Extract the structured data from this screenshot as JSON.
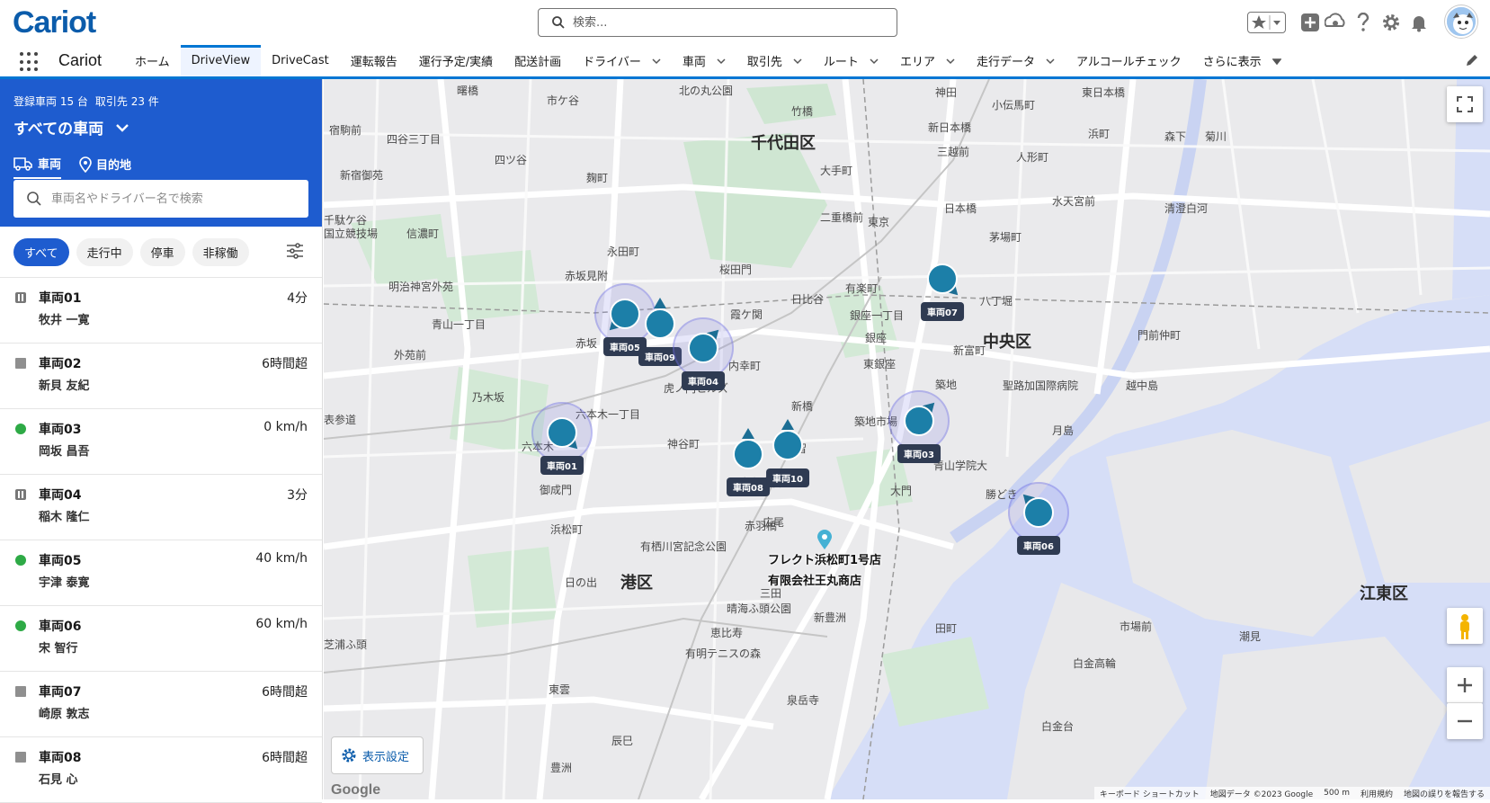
{
  "header": {
    "logo": "Cariot",
    "search_placeholder": "検索..."
  },
  "nav": {
    "app_name": "Cariot",
    "tabs": [
      {
        "label": "ホーム",
        "dropdown": false
      },
      {
        "label": "DriveView",
        "dropdown": false,
        "active": true
      },
      {
        "label": "DriveCast",
        "dropdown": false
      },
      {
        "label": "運転報告",
        "dropdown": false
      },
      {
        "label": "運行予定/実績",
        "dropdown": false
      },
      {
        "label": "配送計画",
        "dropdown": false
      },
      {
        "label": "ドライバー",
        "dropdown": true
      },
      {
        "label": "車両",
        "dropdown": true
      },
      {
        "label": "取引先",
        "dropdown": true
      },
      {
        "label": "ルート",
        "dropdown": true
      },
      {
        "label": "エリア",
        "dropdown": true
      },
      {
        "label": "走行データ",
        "dropdown": true
      },
      {
        "label": "アルコールチェック",
        "dropdown": false
      },
      {
        "label": "さらに表示",
        "dropdown": true
      }
    ]
  },
  "panel": {
    "vehicle_count": "登録車両 15 台",
    "client_count": "取引先 23 件",
    "scope": "すべての車両",
    "mode_vehicle": "車両",
    "mode_destination": "目的地",
    "search_placeholder": "車両名やドライバー名で検索",
    "filters": [
      "すべて",
      "走行中",
      "停車",
      "非稼働"
    ],
    "vehicles": [
      {
        "name": "車両01",
        "driver": "牧井 一寛",
        "value": "4分",
        "status": "pause"
      },
      {
        "name": "車両02",
        "driver": "新貝 友紀",
        "value": "6時間超",
        "status": "stop"
      },
      {
        "name": "車両03",
        "driver": "岡坂 昌吾",
        "value": "0 km/h",
        "status": "run"
      },
      {
        "name": "車両04",
        "driver": "稲木 隆仁",
        "value": "3分",
        "status": "pause"
      },
      {
        "name": "車両05",
        "driver": "宇津 泰寛",
        "value": "40 km/h",
        "status": "run"
      },
      {
        "name": "車両06",
        "driver": "宋 智行",
        "value": "60 km/h",
        "status": "run"
      },
      {
        "name": "車両07",
        "driver": "崎原 敦志",
        "value": "6時間超",
        "status": "stop"
      },
      {
        "name": "車両08",
        "driver": "石見 心",
        "value": "6時間超",
        "status": "stop"
      }
    ]
  },
  "map": {
    "wards": [
      "千代田区",
      "中央区",
      "港区",
      "江東区"
    ],
    "places": [
      "曙橋",
      "市ケ谷",
      "北の丸公園",
      "神田",
      "小伝馬町",
      "東日本橋",
      "宿駒前",
      "四谷三丁目",
      "四ツ谷",
      "麹町",
      "竹橋",
      "新日本橋",
      "三越前",
      "人形町",
      "浜町",
      "森下",
      "菊川",
      "新宿御苑",
      "大手町",
      "千駄ケ谷",
      "国立競技場",
      "信濃町",
      "二重橋前",
      "東京",
      "日本橋",
      "水天宮前",
      "清澄白河",
      "茅場町",
      "永田町",
      "桜田門",
      "赤坂見附",
      "明治神宮外苑",
      "日比谷",
      "有楽町",
      "銀座一丁目",
      "八丁堀",
      "青山一丁目",
      "霞ケ関",
      "内幸町",
      "銀座",
      "新富町",
      "門前仲町",
      "外苑前",
      "赤坂",
      "東銀座",
      "築地",
      "聖路加国際病院",
      "越中島",
      "乃木坂",
      "虎ノ門ヒルズ",
      "新橋",
      "表参道",
      "六本木一丁目",
      "築地市場",
      "月島",
      "六本木",
      "神谷町",
      "汐留",
      "青山学院大",
      "勝どき",
      "御成門",
      "麻布十番",
      "大門",
      "赤羽橋",
      "浜松町",
      "広尾",
      "有栖川宮記念公園",
      "日の出",
      "三田",
      "晴海ふ頭公園",
      "新豊洲",
      "恵比寿",
      "田町",
      "市場前",
      "芝浦ふ頭",
      "有明テニスの森",
      "白金高輪",
      "泉岳寺",
      "白金台",
      "東雲",
      "辰巳",
      "豊洲",
      "潮見"
    ],
    "vehicles": [
      {
        "label": "車両01"
      },
      {
        "label": "車両05"
      },
      {
        "label": "車両09"
      },
      {
        "label": "車両04"
      },
      {
        "label": "車両08"
      },
      {
        "label": "車両10"
      },
      {
        "label": "車両07"
      },
      {
        "label": "車両03"
      },
      {
        "label": "車両06"
      }
    ],
    "stores": [
      "フレクト浜松町1号店",
      "有限会社王丸商店"
    ],
    "display_settings": "表示設定",
    "attribution": {
      "keyboard": "キーボード ショートカット",
      "data": "地図データ ©2023 Google",
      "scale": "500 m",
      "terms": "利用規約",
      "report": "地図の誤りを報告する",
      "google": "Google"
    }
  },
  "colors": {
    "brand_blue": "#1e5ccf",
    "marker": "#1c7fa8",
    "label_bg": "#2f3b52",
    "running_green": "#2eaa46"
  }
}
